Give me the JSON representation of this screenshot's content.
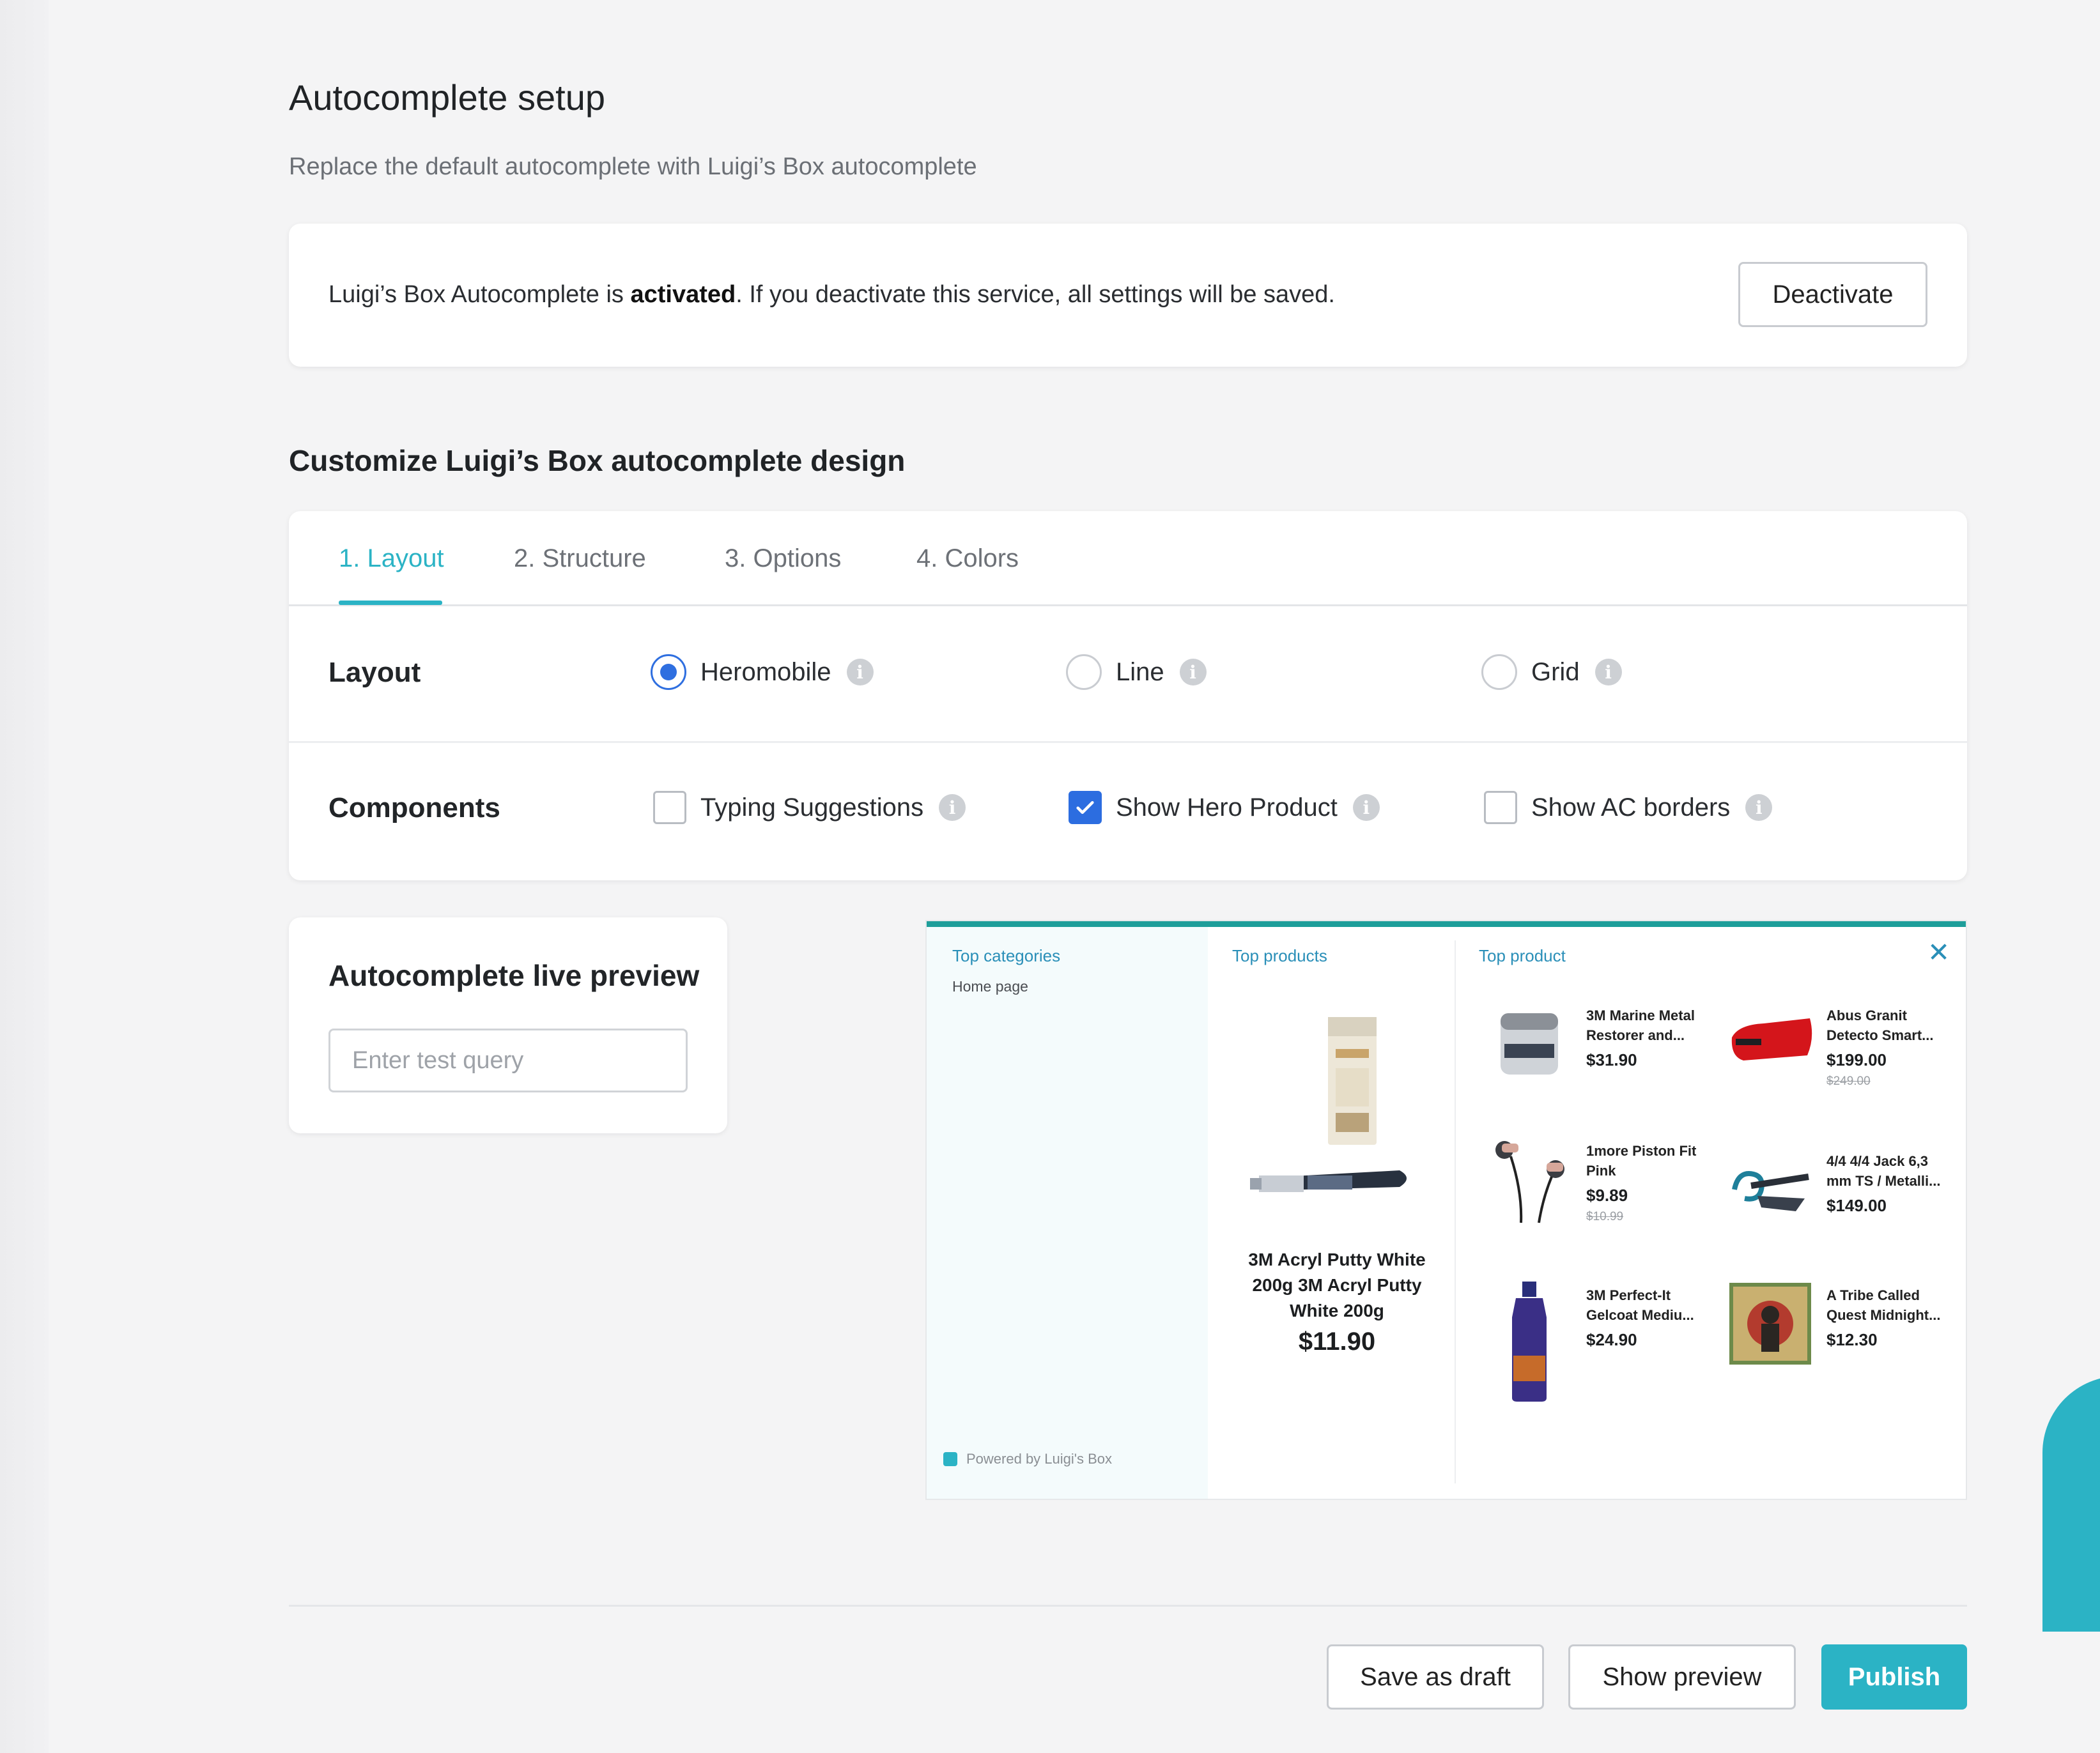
{
  "page": {
    "title": "Autocomplete setup",
    "subtitle": "Replace the default autocomplete with Luigi’s Box autocomplete"
  },
  "status": {
    "prefix": "Luigi’s Box Autocomplete is ",
    "state": "activated",
    "suffix": ". If you deactivate this service, all settings will be saved.",
    "deactivate_label": "Deactivate"
  },
  "customize": {
    "title": "Customize Luigi’s Box autocomplete design",
    "tabs": [
      {
        "label": "1. Layout",
        "active": true
      },
      {
        "label": "2. Structure",
        "active": false
      },
      {
        "label": "3. Options",
        "active": false
      },
      {
        "label": "4. Colors",
        "active": false
      }
    ],
    "layout": {
      "label": "Layout",
      "options": [
        {
          "label": "Heromobile",
          "selected": true
        },
        {
          "label": "Line",
          "selected": false
        },
        {
          "label": "Grid",
          "selected": false
        }
      ]
    },
    "components": {
      "label": "Components",
      "options": [
        {
          "label": "Typing Suggestions",
          "checked": false
        },
        {
          "label": "Show Hero Product",
          "checked": true
        },
        {
          "label": "Show AC borders",
          "checked": false
        }
      ]
    },
    "info_glyph": "i"
  },
  "live_preview": {
    "title": "Autocomplete live preview",
    "input_placeholder": "Enter test query",
    "input_value": ""
  },
  "ac": {
    "top_categories": "Top categories",
    "home_page": "Home page",
    "top_products": "Top products",
    "top_product": "Top product",
    "powered_by": "Powered by Luigi's Box",
    "close_glyph": "✕",
    "hero": {
      "name": "3M Acryl Putty White 200g 3M Acryl Putty White 200g",
      "price": "$11.90"
    },
    "products": [
      {
        "name": "3M Marine Metal Restorer and...",
        "price": "$31.90",
        "old_price": ""
      },
      {
        "name": "Abus Granit Detecto Smart...",
        "price": "$199.00",
        "old_price": "$249.00"
      },
      {
        "name": "1more Piston Fit Pink",
        "price": "$9.89",
        "old_price": "$10.99"
      },
      {
        "name": "4/4 4/4 Jack 6,3 mm TS / Metalli...",
        "price": "$149.00",
        "old_price": ""
      },
      {
        "name": "3M Perfect-It Gelcoat Mediu...",
        "price": "$24.90",
        "old_price": ""
      },
      {
        "name": "A Tribe Called Quest Midnight...",
        "price": "$12.30",
        "old_price": ""
      }
    ]
  },
  "footer": {
    "save_draft": "Save as draft",
    "show_preview": "Show preview",
    "publish": "Publish"
  },
  "colors": {
    "accent": "#2bb3c5",
    "radio_checkbox": "#2c6de0",
    "ac_bar": "#1e9e9a"
  }
}
